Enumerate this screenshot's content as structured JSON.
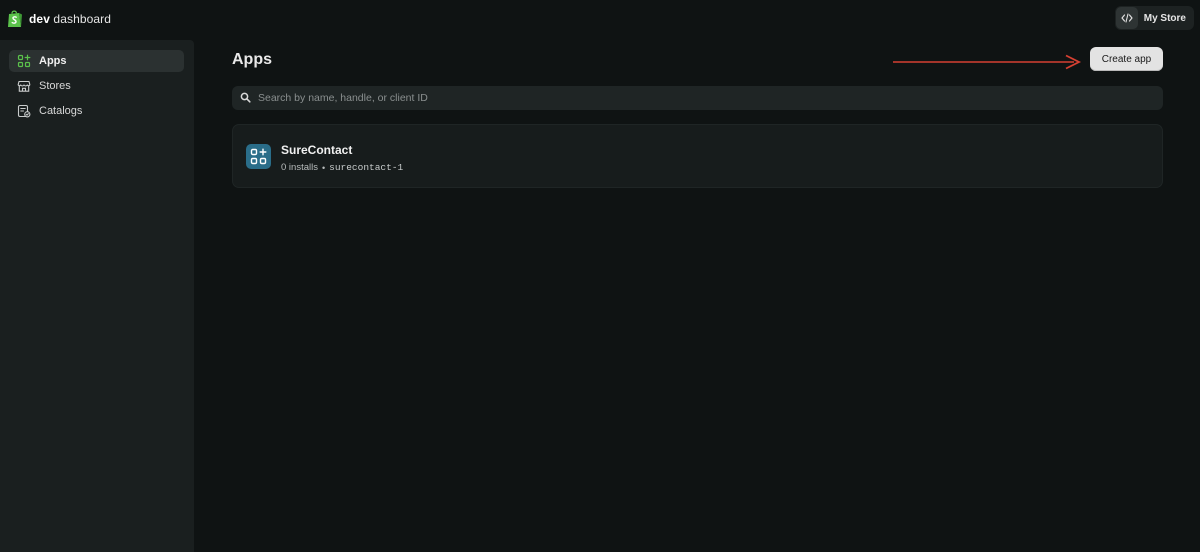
{
  "brand": {
    "bold": "dev",
    "rest": "dashboard",
    "color": "#5bc24b"
  },
  "store_switcher": {
    "icon": "code-icon",
    "label": "My Store"
  },
  "sidebar": {
    "items": [
      {
        "label": "Apps",
        "icon": "apps-grid-icon",
        "active": true
      },
      {
        "label": "Stores",
        "icon": "storefront-icon",
        "active": false
      },
      {
        "label": "Catalogs",
        "icon": "catalog-icon",
        "active": false
      }
    ]
  },
  "main": {
    "title": "Apps",
    "create_button": "Create app",
    "search": {
      "placeholder": "Search by name, handle, or client ID",
      "value": ""
    },
    "apps": [
      {
        "name": "SureContact",
        "installs": "0 installs",
        "separator": "•",
        "handle": "surecontact-1",
        "icon": "app-grid-plus-icon",
        "icon_color": "#2a6d89"
      }
    ]
  },
  "annotation": {
    "arrow_color": "#d64032"
  }
}
